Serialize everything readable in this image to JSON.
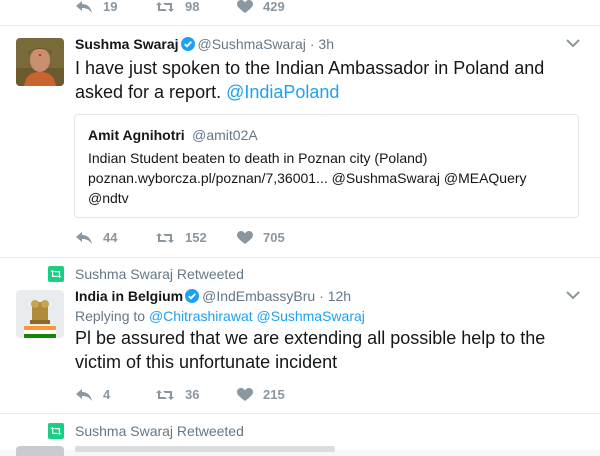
{
  "top_tweet": {
    "reply_count": "19",
    "retweet_count": "98",
    "like_count": "429"
  },
  "tweet1": {
    "name": "Sushma Swaraj",
    "handle": "@SushmaSwaraj",
    "time": "· 3h",
    "text_line1": "I have just spoken to the Indian Ambassador in Poland and",
    "text_line2": "asked for a report. ",
    "mention": "@IndiaPoland",
    "quote": {
      "name": "Amit Agnihotri",
      "handle": "@amit02A",
      "line1": "Indian Student beaten to death in Poznan city (Poland)",
      "line2": "poznan.wyborcza.pl/poznan/7,36001... @SushmaSwaraj @MEAQuery",
      "line3": "@ndtv"
    },
    "reply_count": "44",
    "retweet_count": "152",
    "like_count": "705"
  },
  "tweet2": {
    "retweeted_by": "Sushma Swaraj Retweeted",
    "name": "India in Belgium",
    "handle": "@IndEmbassyBru",
    "time": "· 12h",
    "replying_prefix": "Replying to ",
    "replying_to": "@Chitrashirawat @SushmaSwaraj",
    "text_line1": "Pl be assured that we are extending all possible help to the",
    "text_line2": "victim of this unfortunate incident",
    "reply_count": "4",
    "retweet_count": "36",
    "like_count": "215"
  },
  "tweet3": {
    "retweeted_by": "Sushma Swaraj Retweeted"
  },
  "colors": {
    "link": "#1da1f2",
    "retweet_green": "#19cf86",
    "icon_grey": "#8a96a0",
    "verified": "#1da1f2"
  }
}
